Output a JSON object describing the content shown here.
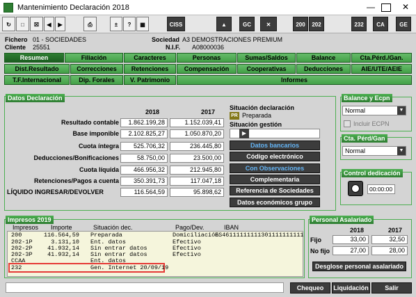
{
  "window": {
    "title": "Mantenimiento Declaración 2018"
  },
  "toolbar": {
    "ciss": "CISS",
    "gc": "GC",
    "y1": "200",
    "y2": "202",
    "m232": "232",
    "ca": "CA",
    "ge": "GE"
  },
  "info": {
    "fichero_label": "Fichero",
    "fichero_value": "01 - SOCIEDADES",
    "cliente_label": "Cliente",
    "cliente_value": "25551",
    "sociedad_label": "Sociedad",
    "sociedad_value": "A3 DEMOSTRACIONES PREMIUM",
    "nif_label": "N.I.F.",
    "nif_value": "A08000036"
  },
  "tabs": {
    "row1": [
      "Resumen",
      "Filiación",
      "Caracteres",
      "Personas",
      "Sumas/Saldos",
      "Balance",
      "Cta.Pérd./Gan."
    ],
    "row2": [
      "Dist.Resultado",
      "Correcciones",
      "Retenciones",
      "Compensación",
      "Cooperativas",
      "Deducciones",
      "AIE/UTE/AEIE"
    ],
    "row3": [
      "T.F.Internacional",
      "Dip. Forales",
      "V. Patrimonio",
      "Informes"
    ]
  },
  "datos": {
    "title": "Datos Declaración",
    "year_a": "2018",
    "year_b": "2017",
    "rows": [
      {
        "label": "Resultado contable",
        "a": "1.862.199,28",
        "b": "1.152.039,41"
      },
      {
        "label": "Base imponible",
        "a": "2.102.825,27",
        "b": "1.050.870,20"
      },
      {
        "label": "Cuota íntegra",
        "a": "525.706,32",
        "b": "236.445,80"
      },
      {
        "label": "Deducciones/Bonificaciones",
        "a": "58.750,00",
        "b": "23.500,00"
      },
      {
        "label": "Cuota líquida",
        "a": "466.956,32",
        "b": "212.945,80"
      },
      {
        "label": "Retenciones/Pagos a cuenta",
        "a": "350.391,73",
        "b": "117.047,18"
      },
      {
        "label": "LÍQUIDO INGRESAR/DEVOLVER",
        "a": "116.564,59",
        "b": "95.898,62"
      }
    ],
    "situacion_label": "Situación declaración",
    "situacion_badge": "PR",
    "situacion_value": "Preparada",
    "gestion_label": "Situación gestión",
    "buttons": [
      "Datos bancarios",
      "Código electrónico",
      "Con Observaciones",
      "Complementaria",
      "Referencia de Sociedades",
      "Datos económicos grupo"
    ]
  },
  "balance": {
    "title": "Balance y Ecpn",
    "combo": "Normal",
    "checkbox": "Incluir ECPN"
  },
  "ctaperd": {
    "title": "Cta. Pérd/Gan",
    "combo": "Normal"
  },
  "dedicacion": {
    "title": "Control dedicación",
    "time": "00:00:00"
  },
  "impresos": {
    "title": "Impresos 2019",
    "headers": [
      "Impresos",
      "Importe",
      "Situación dec.",
      "Pago/Dev.",
      "IBAN"
    ],
    "rows": [
      [
        "200",
        "116.564,59",
        "Preparada",
        "Domiciliación",
        "ES46111111111301111111111"
      ],
      [
        "202-1P",
        "3.131,10",
        "Ent. datos",
        "Efectivo",
        ""
      ],
      [
        "202-2P",
        "41.932,14",
        "Sin entrar datos",
        "Efectivo",
        ""
      ],
      [
        "202-3P",
        "41.932,14",
        "Sin entrar datos",
        "Efectivo",
        ""
      ],
      [
        "CCAA",
        "",
        "Ent. datos",
        "",
        ""
      ],
      [
        "232",
        "",
        "Gen. Internet 20/09/19",
        "",
        ""
      ]
    ]
  },
  "personal": {
    "title": "Personal Asalariado",
    "year_a": "2018",
    "year_b": "2017",
    "fijo_label": "Fijo",
    "fijo_a": "33,00",
    "fijo_b": "32,50",
    "nofijo_label": "No fijo",
    "nofijo_a": "27,00",
    "nofijo_b": "28,00",
    "desglose": "Desglose personal asalariado"
  },
  "footer": {
    "cheque": "Chequeo",
    "liquidacion": "Liquidación",
    "salir": "Salir"
  },
  "colors": {
    "accent": "#2e7d32",
    "highlight": "#e53935"
  }
}
